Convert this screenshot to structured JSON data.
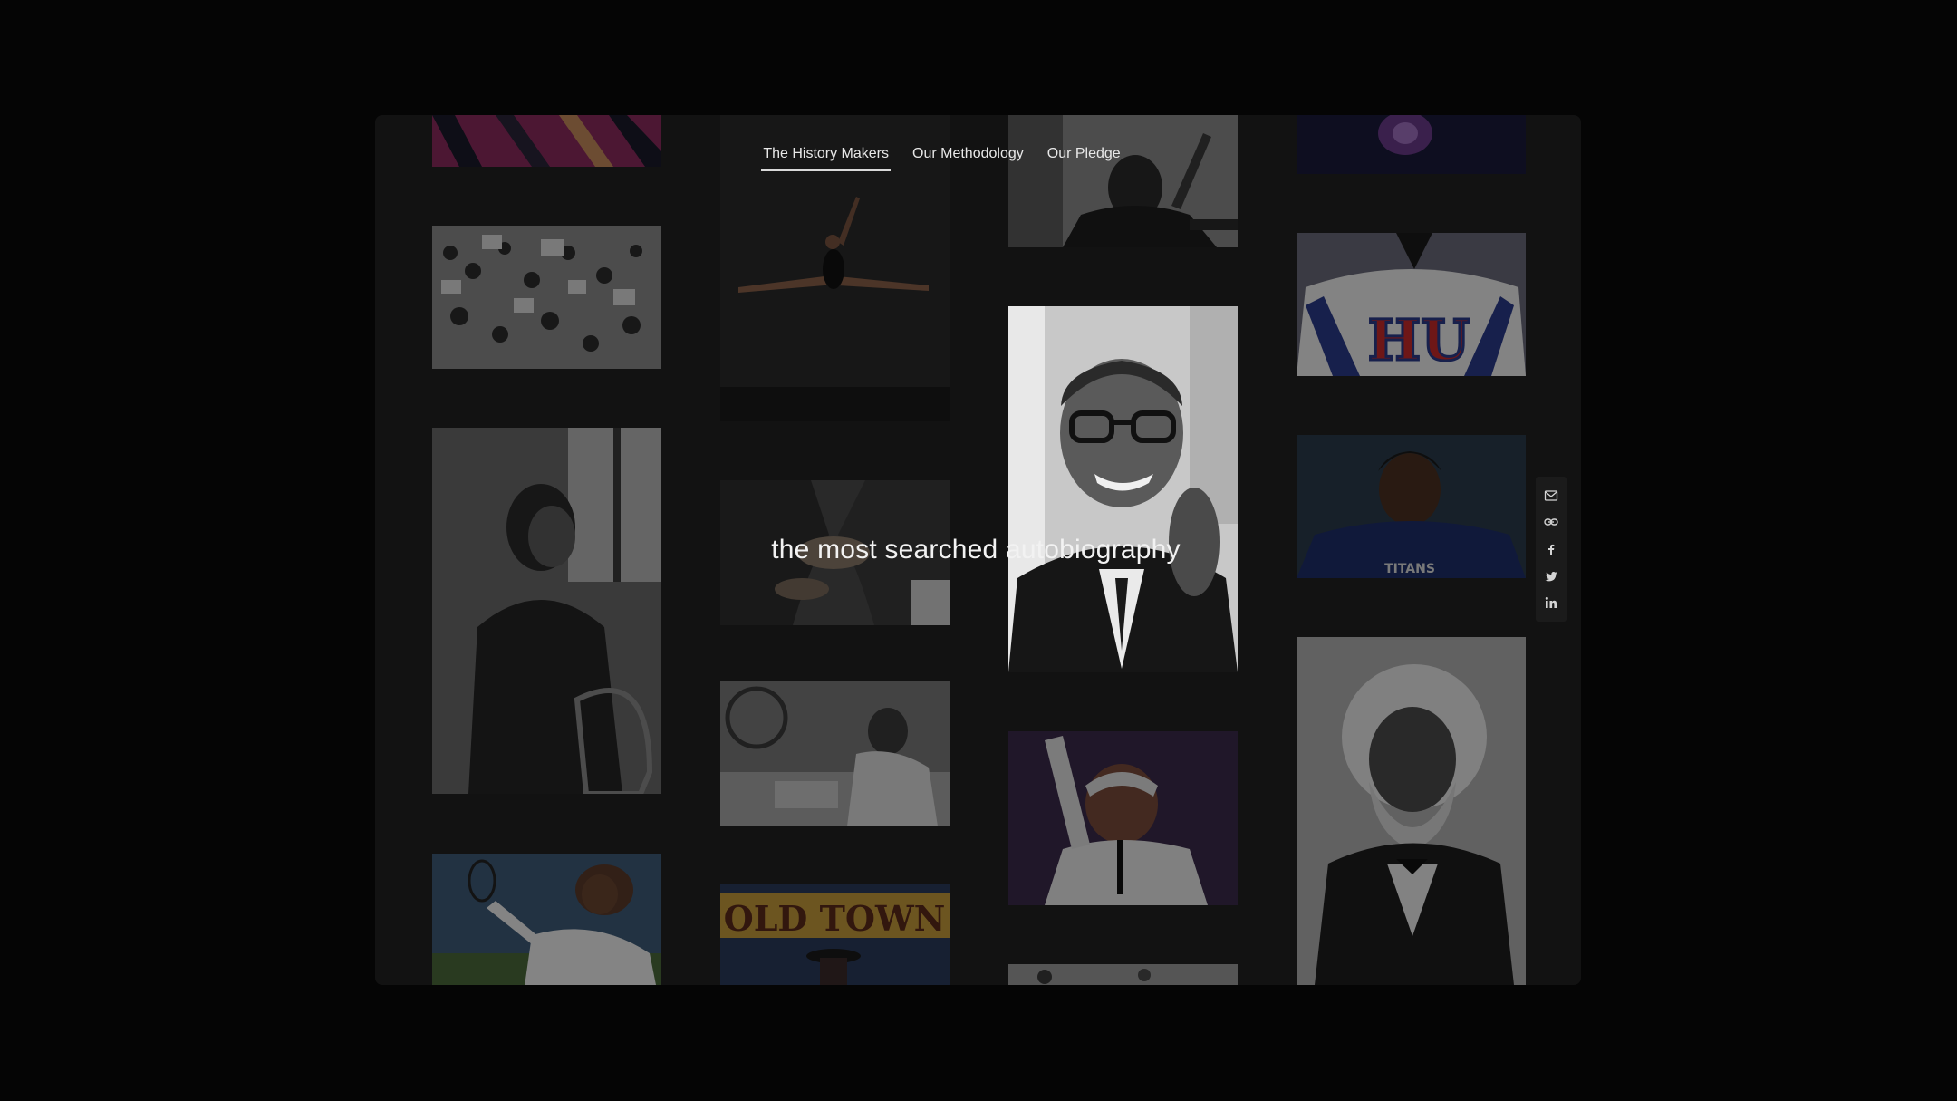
{
  "nav": {
    "items": [
      {
        "label": "The History Makers",
        "active": true
      },
      {
        "label": "Our Methodology",
        "active": false
      },
      {
        "label": "Our Pledge",
        "active": false
      }
    ]
  },
  "headline": "the most searched autobiography",
  "share": {
    "icons": [
      "mail-icon",
      "link-icon",
      "facebook-icon",
      "twitter-icon",
      "linkedin-icon"
    ]
  },
  "photos": {
    "jersey_text": "HU",
    "helmet_text": "TITANS",
    "sign_text": "OLD TOWN"
  },
  "colors": {
    "page_bg": "#050505",
    "frame_bg": "#121212",
    "text": "#f2f2f2"
  }
}
